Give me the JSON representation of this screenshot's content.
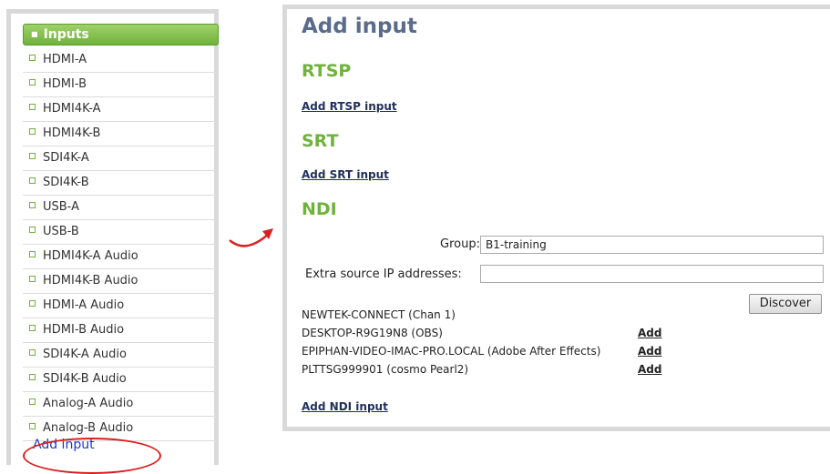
{
  "sidebar": {
    "header": "Inputs",
    "items": [
      "HDMI-A",
      "HDMI-B",
      "HDMI4K-A",
      "HDMI4K-B",
      "SDI4K-A",
      "SDI4K-B",
      "USB-A",
      "USB-B",
      "HDMI4K-A Audio",
      "HDMI4K-B Audio",
      "HDMI-A Audio",
      "HDMI-B Audio",
      "SDI4K-A Audio",
      "SDI4K-B Audio",
      "Analog-A Audio",
      "Analog-B Audio"
    ],
    "add_input": "Add input"
  },
  "main": {
    "title": "Add input",
    "rtsp": {
      "heading": "RTSP",
      "link": "Add RTSP input"
    },
    "srt": {
      "heading": "SRT",
      "link": "Add SRT input"
    },
    "ndi": {
      "heading": "NDI",
      "group_label": "Group:",
      "group_value": "B1-training",
      "extra_ip_label": "Extra source IP addresses:",
      "extra_ip_value": "",
      "discover_label": "Discover",
      "sources": [
        {
          "name": "NEWTEK-CONNECT (Chan 1)",
          "action": ""
        },
        {
          "name": "DESKTOP-R9G19N8 (OBS)",
          "action": "Add"
        },
        {
          "name": "EPIPHAN-VIDEO-IMAC-PRO.LOCAL (Adobe After Effects)",
          "action": "Add"
        },
        {
          "name": "PLTTSG999901 (cosmo Pearl2)",
          "action": "Add"
        }
      ],
      "link": "Add NDI input"
    }
  },
  "colors": {
    "header_green": "#6fb33a",
    "title_blue": "#5a6b8c",
    "highlight_red": "#d92020",
    "link_blue": "#1a35c9"
  }
}
